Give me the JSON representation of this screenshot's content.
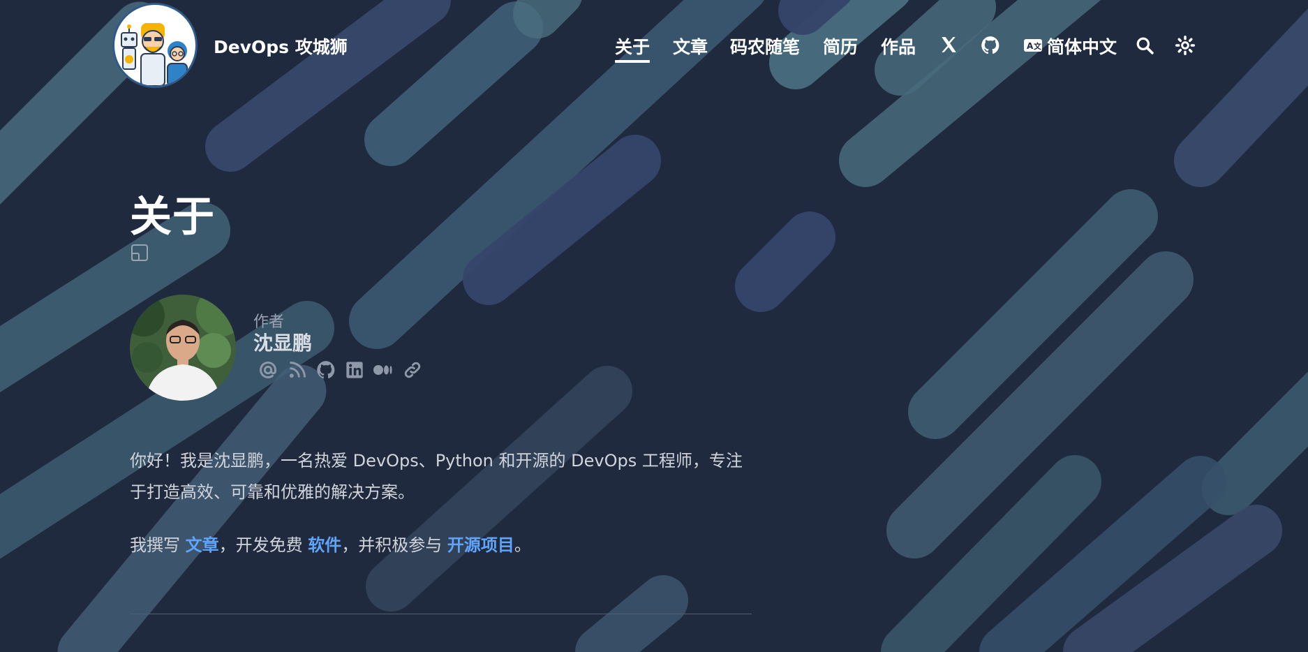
{
  "header": {
    "site_title": "DevOps 攻城狮",
    "nav": [
      {
        "label": "关于",
        "active": true
      },
      {
        "label": "文章",
        "active": false
      },
      {
        "label": "码农随笔",
        "active": false
      },
      {
        "label": "简历",
        "active": false
      },
      {
        "label": "作品",
        "active": false
      }
    ],
    "language_label": "简体中文",
    "icons": [
      "x-icon",
      "github-icon",
      "language-icon",
      "search-icon",
      "theme-toggle-icon"
    ]
  },
  "page": {
    "title": "关于"
  },
  "author": {
    "label": "作者",
    "name": "沈显鹏",
    "social_icons": [
      "email-icon",
      "rss-icon",
      "github-icon",
      "linkedin-icon",
      "medium-icon",
      "link-icon"
    ]
  },
  "content": {
    "intro": "你好！我是沈显鹏，一名热爱 DevOps、Python 和开源的 DevOps 工程师，专注于打造高效、可靠和优雅的解决方案。",
    "p2_prefix": "我撰写 ",
    "p2_link1": "文章",
    "p2_mid1": "，开发免费 ",
    "p2_link2": "软件",
    "p2_mid2": "，并积极参与 ",
    "p2_link3": "开源项目",
    "p2_suffix": "。"
  },
  "colors": {
    "background": "#1f2a3e",
    "link": "#60a5fa",
    "stripe_teal": "#4a6e80",
    "stripe_slate": "#394a6a"
  }
}
